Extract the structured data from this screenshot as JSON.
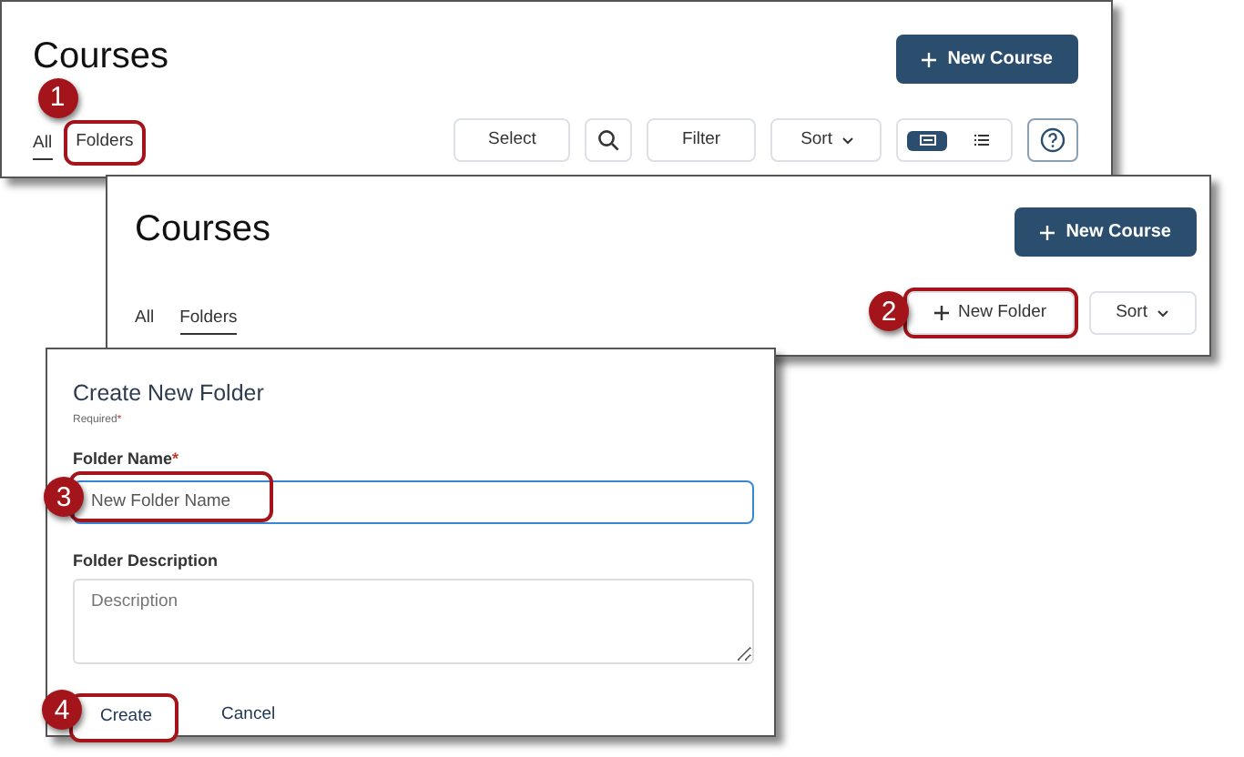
{
  "course_page": {
    "title": "Courses",
    "new_course_button": "New Course",
    "tabs": [
      {
        "label": "All",
        "selected": true
      },
      {
        "label": "Folders",
        "selected": false,
        "callout": "1"
      }
    ],
    "toolbar": [
      {
        "kind": "text",
        "label": "Select"
      },
      {
        "kind": "search"
      },
      {
        "kind": "text",
        "label": "Filter"
      },
      {
        "kind": "sort",
        "label": "Sort"
      },
      {
        "kind": "view"
      },
      {
        "kind": "help"
      }
    ],
    "views": [
      {
        "kind": "grid",
        "selected": true
      },
      {
        "kind": "list",
        "selected": false
      }
    ]
  },
  "folders_page": {
    "title": "Courses",
    "new_course_button": "New Course",
    "tabs": [
      {
        "label": "All",
        "selected": false
      },
      {
        "label": "Folders",
        "selected": true
      }
    ],
    "new_folder_button": {
      "label": "New Folder",
      "callout": "2"
    },
    "sort_button": "Sort"
  },
  "dialog": {
    "title": "Create New Folder",
    "required_note": "Required",
    "asterisk": "*",
    "name_field": {
      "label": "Folder Name",
      "asterisk": "*",
      "value": "New Folder Name",
      "callout": "3"
    },
    "description_field": {
      "label": "Folder Description",
      "placeholder": "Description"
    },
    "create_button": {
      "label": "Create",
      "callout": "4"
    },
    "cancel_button": "Cancel"
  }
}
